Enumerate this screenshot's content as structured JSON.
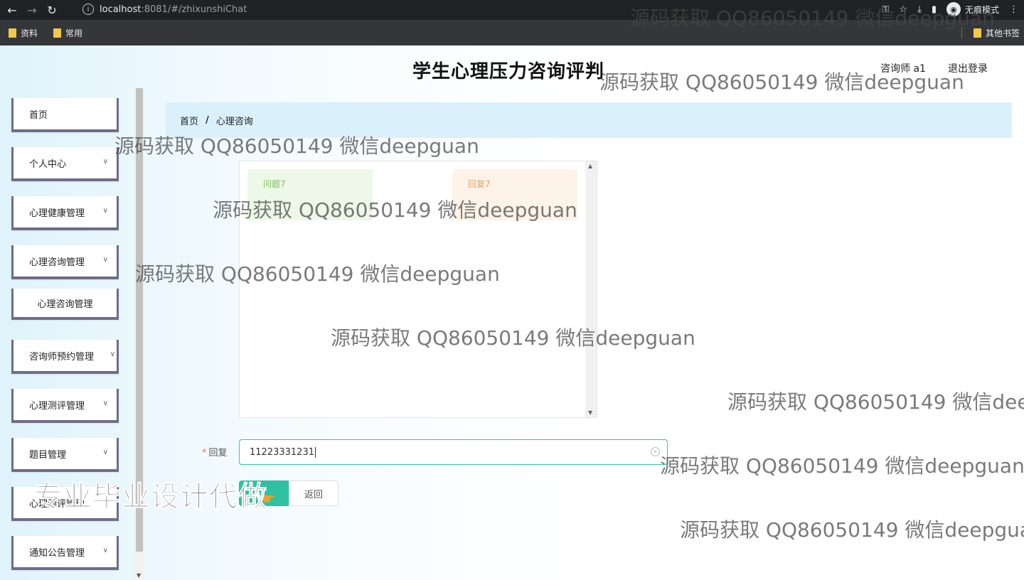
{
  "browser": {
    "url_host": "localhost",
    "url_rest": ":8081/#/zhixunshiChat",
    "incognito_label": "无痕模式",
    "bookmarks": [
      "资料",
      "常用"
    ],
    "other_bookmarks": "其他书签"
  },
  "header": {
    "title": "学生心理压力咨询评判",
    "user": "咨询师 a1",
    "logout": "退出登录"
  },
  "sidebar": {
    "items": [
      {
        "label": "首页",
        "chevron": false
      },
      {
        "label": "个人中心",
        "chevron": true
      },
      {
        "label": "心理健康管理",
        "chevron": true
      },
      {
        "label": "心理咨询管理",
        "chevron": true
      },
      {
        "label": "心理咨询管理",
        "chevron": false
      },
      {
        "label": "咨询师预约管理",
        "chevron": true
      },
      {
        "label": "心理测评管理",
        "chevron": true
      },
      {
        "label": "题目管理",
        "chevron": true
      },
      {
        "label": "心理测评管理",
        "chevron": true
      },
      {
        "label": "通知公告管理",
        "chevron": true
      }
    ]
  },
  "breadcrumb": {
    "home": "首页",
    "separator": "/",
    "current": "心理咨询"
  },
  "chat": {
    "question": "问题7",
    "reply": "回复7"
  },
  "form": {
    "reply_label": "回复",
    "reply_value": "11223331231",
    "back_button": "返回"
  },
  "watermarks": {
    "text": "源码获取 QQ86050149 微信deepguan",
    "ad": "专业毕业设计代做"
  }
}
